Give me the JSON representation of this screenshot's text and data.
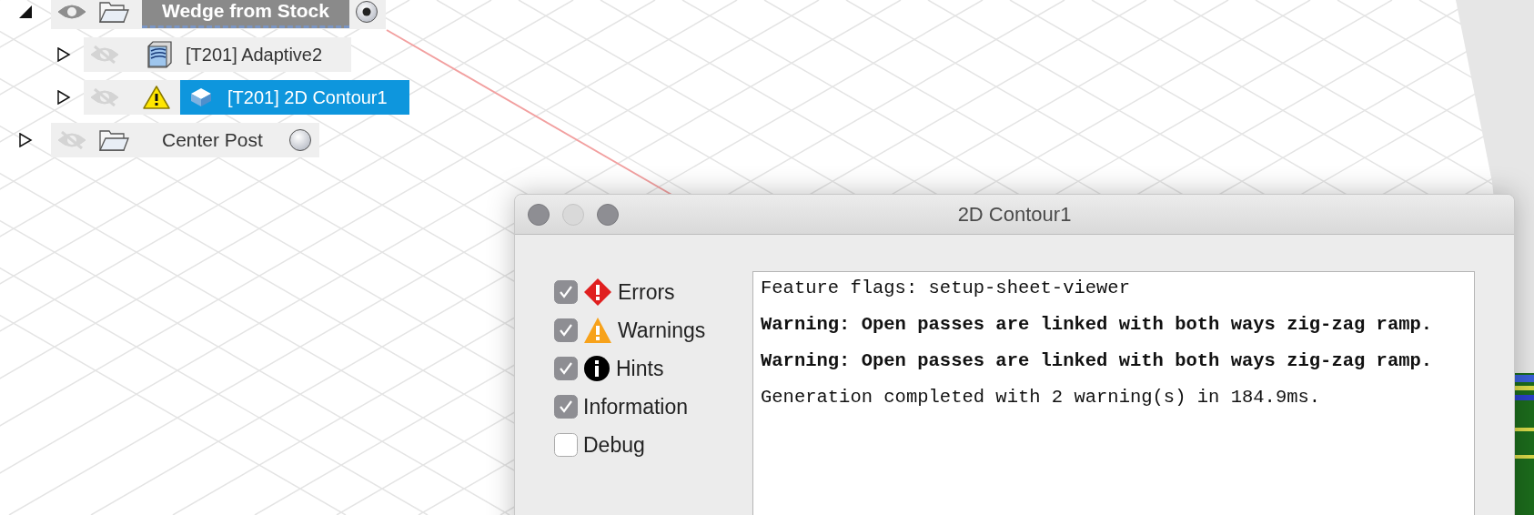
{
  "browser_tree": [
    {
      "name": "Wedge from Stock",
      "expanded": true,
      "visible": true,
      "active": true,
      "children": [
        {
          "name": "[T201] Adaptive2",
          "kind": "adaptive",
          "expanded": false,
          "visible": false,
          "warning": false,
          "selected": false
        },
        {
          "name": "[T201] 2D Contour1",
          "kind": "contour",
          "expanded": false,
          "visible": false,
          "warning": true,
          "selected": true
        }
      ]
    },
    {
      "name": "Center Post",
      "expanded": false,
      "visible": false,
      "active": false
    }
  ],
  "dialog": {
    "title": "2D Contour1",
    "filters": [
      {
        "label": "Errors",
        "kind": "error",
        "checked": true
      },
      {
        "label": "Warnings",
        "kind": "warning",
        "checked": true
      },
      {
        "label": "Hints",
        "kind": "hint",
        "checked": true
      },
      {
        "label": "Information",
        "kind": "info",
        "checked": true
      },
      {
        "label": "Debug",
        "kind": "debug",
        "checked": false
      }
    ],
    "log": [
      {
        "text": "Feature flags: setup-sheet-viewer",
        "bold": false
      },
      {
        "text": "Warning: Open passes are linked with both ways zig-zag ramp.",
        "bold": true
      },
      {
        "text": "Warning: Open passes are linked with both ways zig-zag ramp.",
        "bold": true
      },
      {
        "text": "Generation completed with 2 warning(s) in 184.9ms.",
        "bold": false
      }
    ]
  }
}
